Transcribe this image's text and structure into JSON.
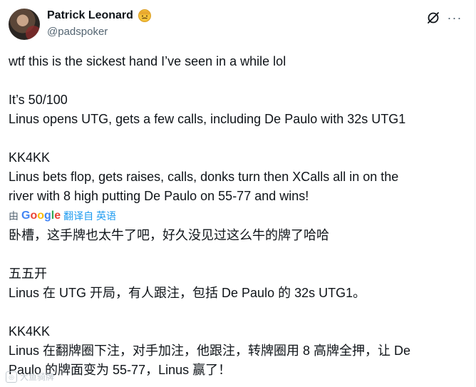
{
  "author": {
    "name": "Patrick Leonard",
    "handle": "@padspoker",
    "badge_icon": "emoji-face-icon"
  },
  "actions": {
    "grok_icon": "grok-icon",
    "more_icon": "more-icon",
    "more_label": "···"
  },
  "original": {
    "lines": [
      "wtf this is the sickest hand I’ve seen in a while lol",
      "",
      "It’s 50/100",
      "Linus opens UTG, gets a few calls, including De Paulo with 32s UTG1",
      "",
      "KK4KK",
      "Linus bets flop, gets raises, calls, donks turn then XCalls all in on the",
      "river with 8 high putting De Paulo on 55-77 and wins!"
    ]
  },
  "translation": {
    "by_label": "由",
    "google_letters": [
      "G",
      "o",
      "o",
      "g",
      "l",
      "e"
    ],
    "link_label": "翻译自 英语",
    "lines": [
      "卧槽，这手牌也太牛了吧，好久没见过这么牛的牌了哈哈",
      "",
      "五五开",
      "Linus 在 UTG 开局，有人跟注，包括 De Paulo 的 32s UTG1。",
      "",
      "KK4KK",
      "Linus 在翻牌圈下注，对手加注，他跟注，转牌圈用 8 高牌全押，让 De",
      "Paulo 的牌面变为 55-77，Linus 赢了！"
    ]
  },
  "watermark": {
    "text": "大鱼骑牌"
  }
}
